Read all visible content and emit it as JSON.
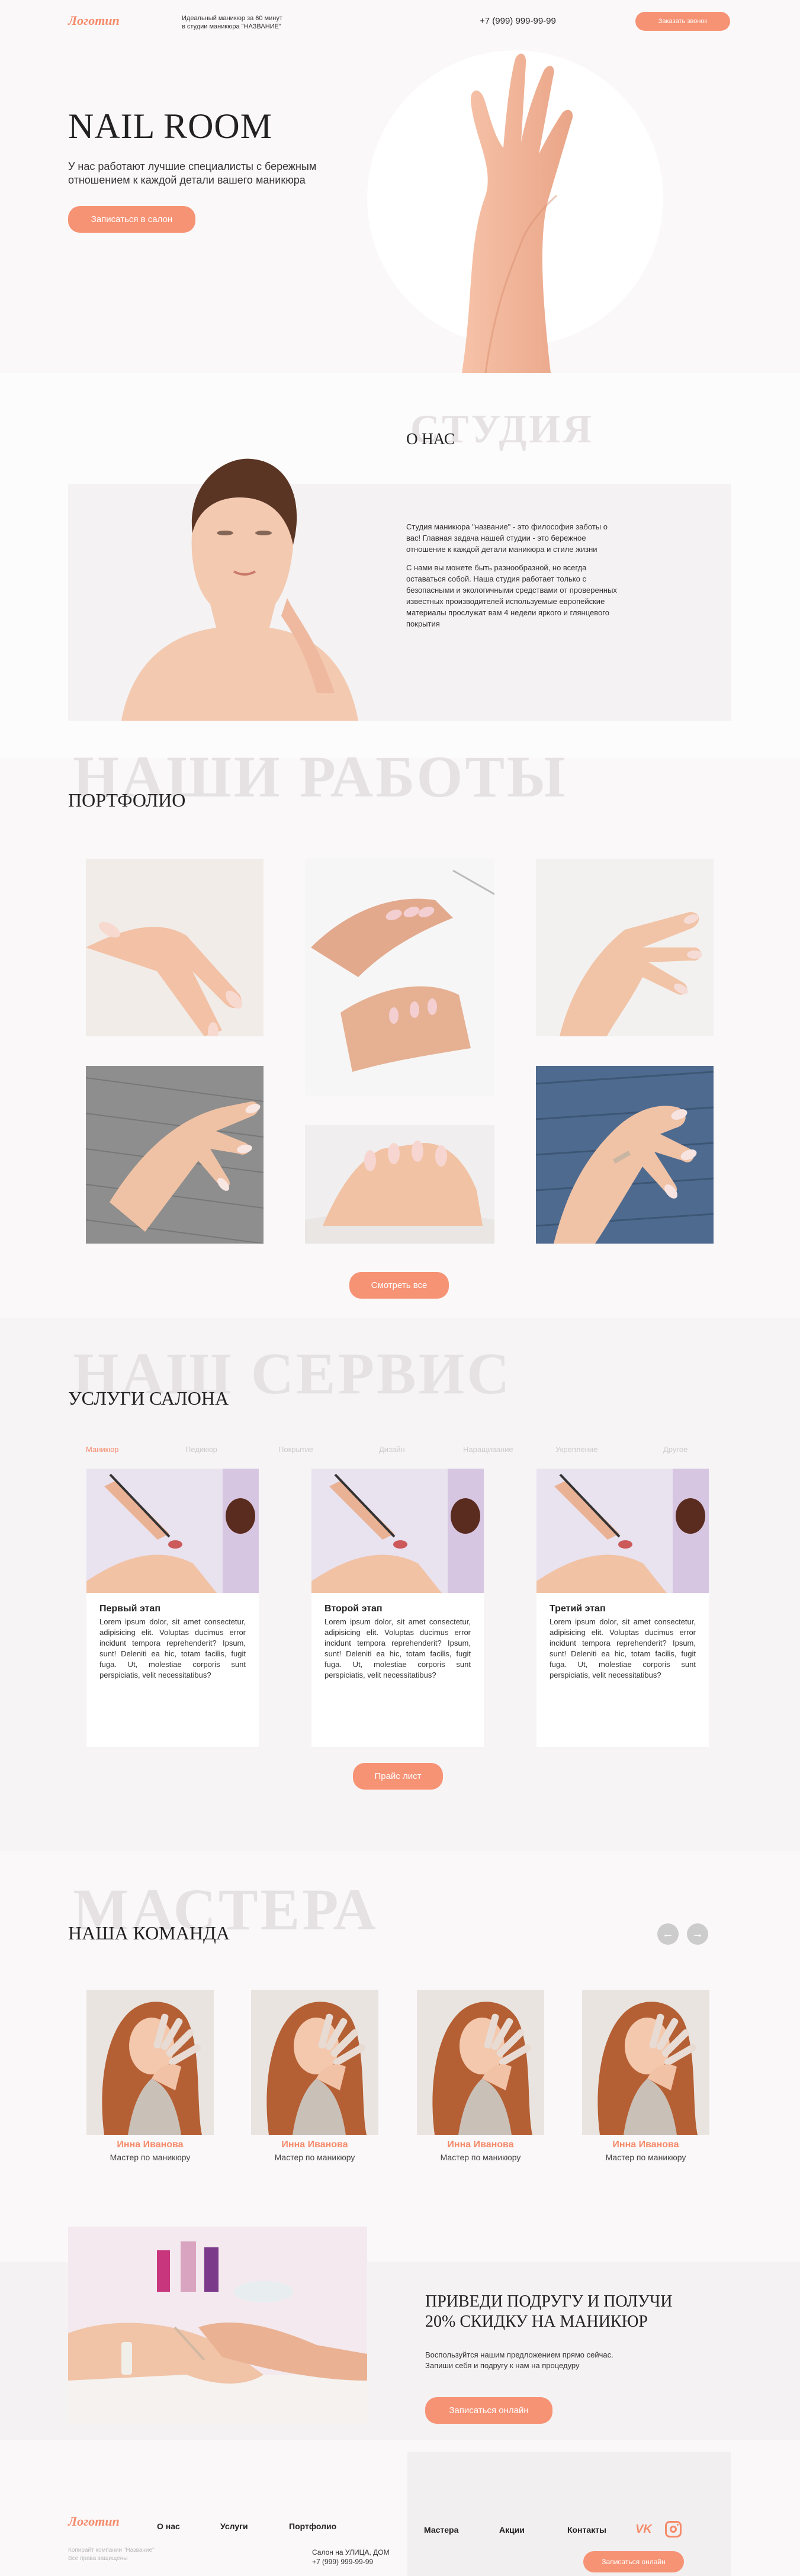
{
  "header": {
    "logo": "Логотип",
    "tagline_1": "Идеальный маникюр за 60 минут",
    "tagline_2": "в студии маникюра \"НАЗВАНИЕ\"",
    "phone": "+7 (999) 999-99-99",
    "call_button": "Заказать звонок"
  },
  "hero": {
    "title": "NAIL ROOM",
    "subtitle_1": "У нас работают лучшие специалисты с бережным",
    "subtitle_2": "отношением к каждой детали вашего маникюра",
    "button": "Записаться в салон"
  },
  "about": {
    "ghost": "СТУДИЯ",
    "title": "О НАС",
    "p1": "Студия маникюра \"название\" - это философия заботы о вас! Главная задача нашей студии - это бережное отношение к каждой детали маникюра и стиле жизни",
    "p2": "С нами вы можете быть разнообразной, но всегда оставаться собой. Наша студия работает только с безопасными и экологичными средствами от проверенных известных производителей используемые европейские материалы прослужат вам 4 недели яркого и глянцевого покрытия"
  },
  "portfolio": {
    "ghost": "НАШИ РАБОТЫ",
    "title": "ПОРТФОЛИО",
    "button": "Смотреть все"
  },
  "services": {
    "ghost": "НАШ СЕРВИС",
    "title": "УСЛУГИ САЛОНА",
    "tabs": [
      "Маникюр",
      "Педикюр",
      "Покрытие",
      "Дизайн",
      "Наращивание",
      "Укрепление",
      "Другое"
    ],
    "cards": [
      {
        "title": "Первый этап",
        "text": "Lorem ipsum dolor, sit amet consectetur, adipisicing elit. Voluptas ducimus error incidunt tempora reprehenderit? Ipsum, sunt! Deleniti ea hic, totam facilis, fugit fuga. Ut, molestiae corporis sunt perspiciatis, velit necessitatibus?"
      },
      {
        "title": "Второй этап",
        "text": "Lorem ipsum dolor, sit amet consectetur, adipisicing elit. Voluptas ducimus error incidunt tempora reprehenderit? Ipsum, sunt! Deleniti ea hic, totam facilis, fugit fuga. Ut, molestiae corporis sunt perspiciatis, velit necessitatibus?"
      },
      {
        "title": "Третий этап",
        "text": "Lorem ipsum dolor, sit amet consectetur, adipisicing elit. Voluptas ducimus error incidunt tempora reprehenderit? Ipsum, sunt! Deleniti ea hic, totam facilis, fugit fuga. Ut, molestiae corporis sunt perspiciatis, velit necessitatibus?"
      }
    ],
    "button": "Прайс лист"
  },
  "team": {
    "ghost": "МАСТЕРА",
    "title": "НАША КОМАНДА",
    "members": [
      {
        "name": "Инна Иванова",
        "role": "Мастер по маникюру"
      },
      {
        "name": "Инна Иванова",
        "role": "Мастер по маникюру"
      },
      {
        "name": "Инна Иванова",
        "role": "Мастер по маникюру"
      },
      {
        "name": "Инна Иванова",
        "role": "Мастер по маникюру"
      }
    ]
  },
  "promo": {
    "title_1": "ПРИВЕДИ ПОДРУГУ И ПОЛУЧИ",
    "title_2": "20% СКИДКУ НА МАНИКЮР",
    "text_1": "Воспользуйтся нашим предложением прямо сейчас.",
    "text_2": "Запиши себя и подругу к нам на процедуру",
    "button": "Записаться онлайн"
  },
  "footer": {
    "logo": "Логотип",
    "copy_1": "Копирайт компании \"Название\"",
    "copy_2": "Все права защищены",
    "nav": [
      "О нас",
      "Услуги",
      "Портфолио",
      "Мастера",
      "Акции",
      "Контакты"
    ],
    "address": "Салон на УЛИЦА, ДОМ",
    "phone": "+7 (999) 999-99-99",
    "social_vk": "VK",
    "button": "Записаться онлайн"
  },
  "colors": {
    "accent": "#f79375",
    "bg": "#faf8f9",
    "ghost": "#e6e2e3"
  }
}
